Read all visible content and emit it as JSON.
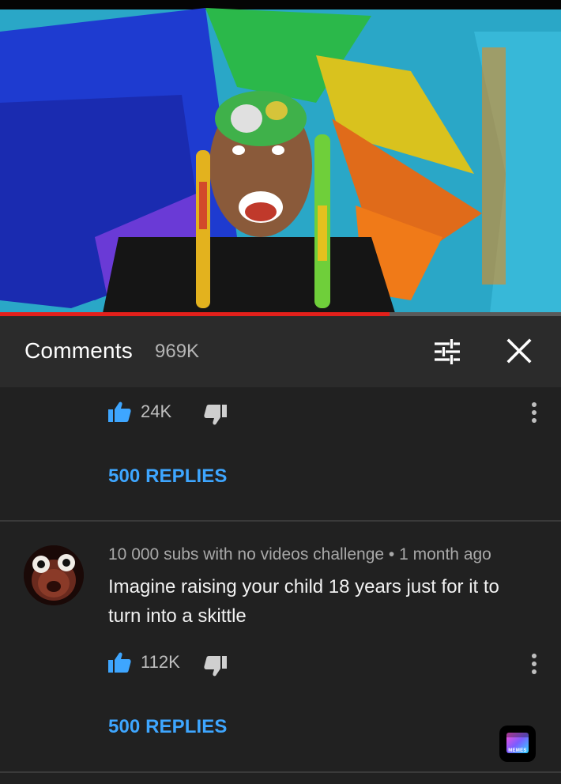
{
  "video": {
    "progress_fraction": 0.695
  },
  "header": {
    "title": "Comments",
    "count": "969K",
    "filter_icon": "sort-filter-icon",
    "close_icon": "close-icon"
  },
  "comments": [
    {
      "likes": "24K",
      "replies_label": "500 REPLIES"
    },
    {
      "author": "10 000 subs with no videos challenge",
      "time": "1 month ago",
      "text": "Imagine raising your child 18 years just for it to turn into a skittle",
      "likes": "112K",
      "replies_label": "500 REPLIES"
    }
  ],
  "watermark": {
    "label": "MEMES"
  },
  "colors": {
    "accent_blue": "#3ea6ff",
    "progress_red": "#e3201b",
    "background": "#212121",
    "header_bg": "#2b2b2b"
  }
}
